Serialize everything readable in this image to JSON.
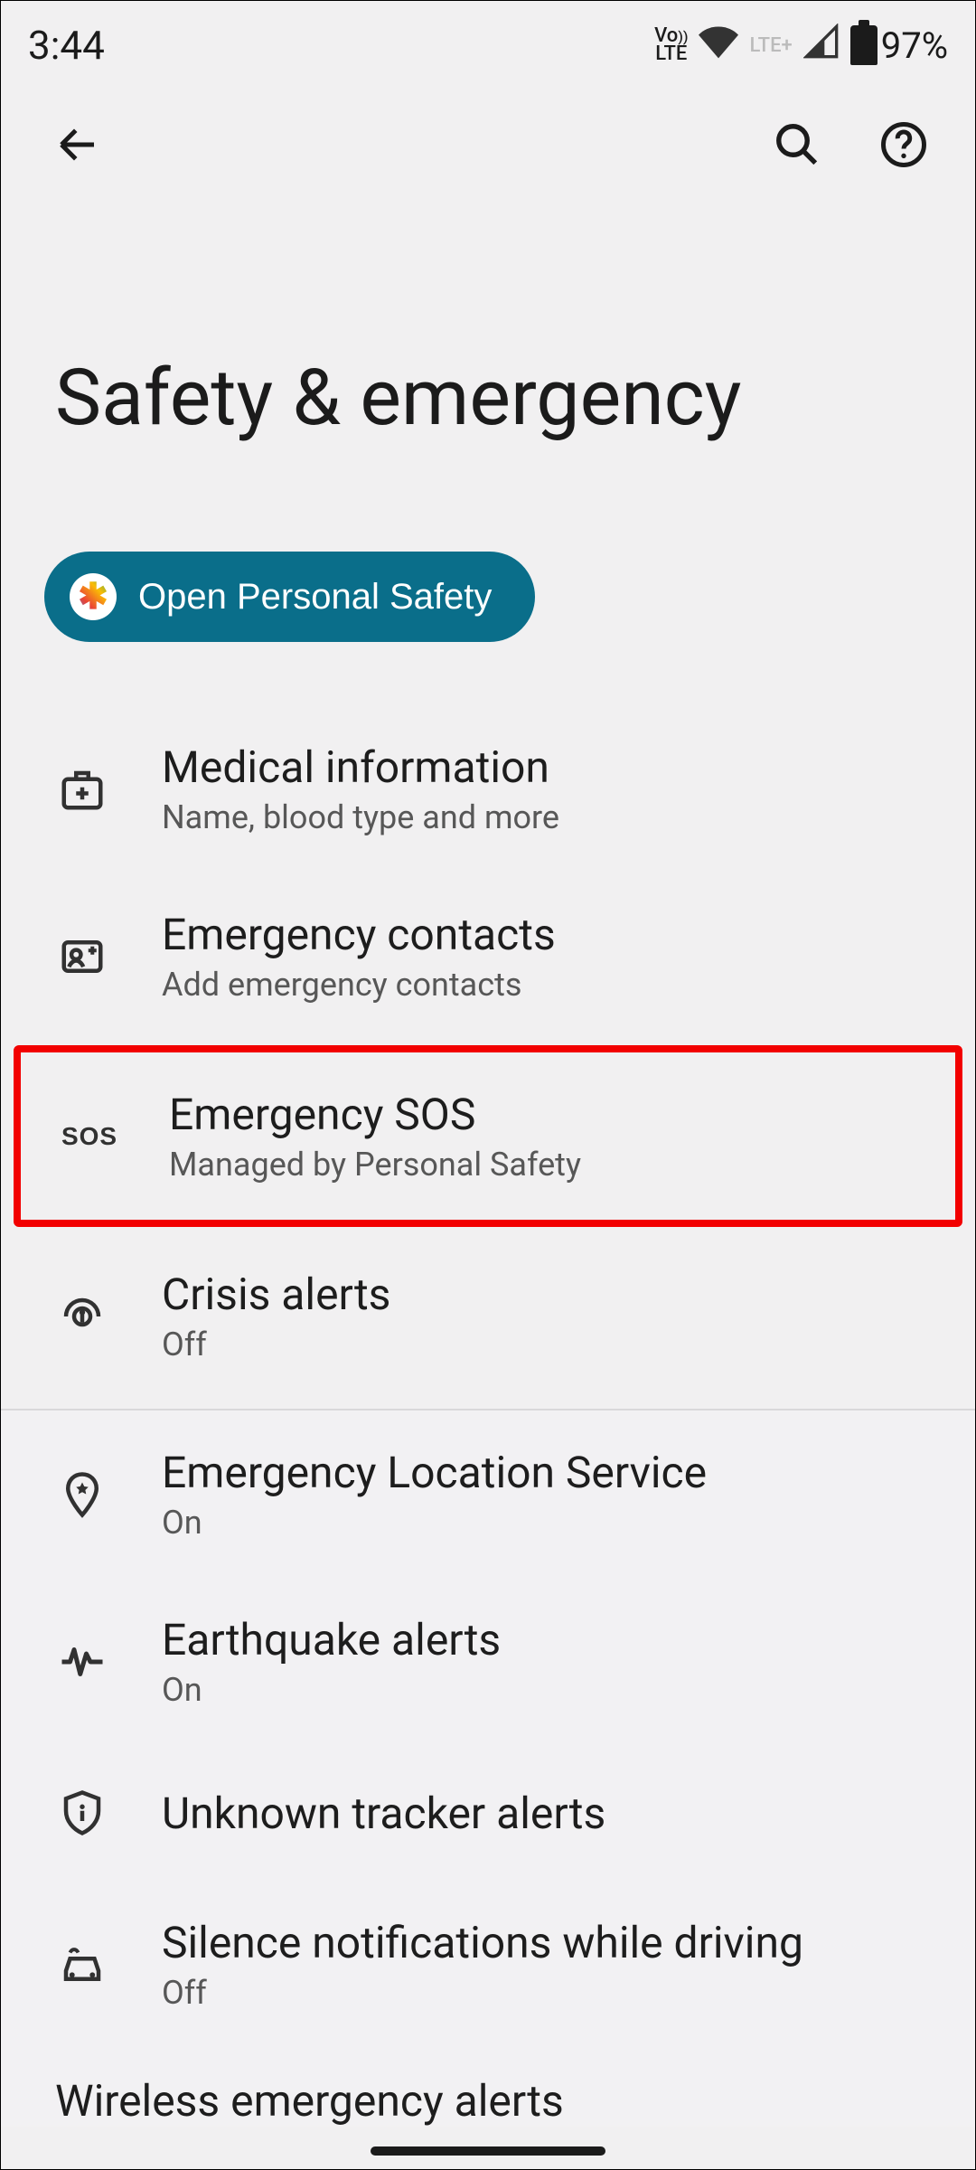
{
  "status": {
    "time": "3:44",
    "volte_top": "Vo",
    "volte_bottom": "LTE",
    "lte_grey": "LTE+",
    "battery": "97%"
  },
  "toolbar": {
    "title": "Safety & emergency"
  },
  "open_button": {
    "label": "Open Personal Safety"
  },
  "items": [
    {
      "title": "Medical information",
      "subtitle": "Name, blood type and more"
    },
    {
      "title": "Emergency contacts",
      "subtitle": "Add emergency contacts"
    },
    {
      "title": "Emergency SOS",
      "subtitle": "Managed by Personal Safety"
    },
    {
      "title": "Crisis alerts",
      "subtitle": "Off"
    },
    {
      "title": "Emergency Location Service",
      "subtitle": "On"
    },
    {
      "title": "Earthquake alerts",
      "subtitle": "On"
    },
    {
      "title": "Unknown tracker alerts",
      "subtitle": ""
    },
    {
      "title": "Silence notifications while driving",
      "subtitle": "Off"
    },
    {
      "title": "Wireless emergency alerts",
      "subtitle": ""
    }
  ]
}
